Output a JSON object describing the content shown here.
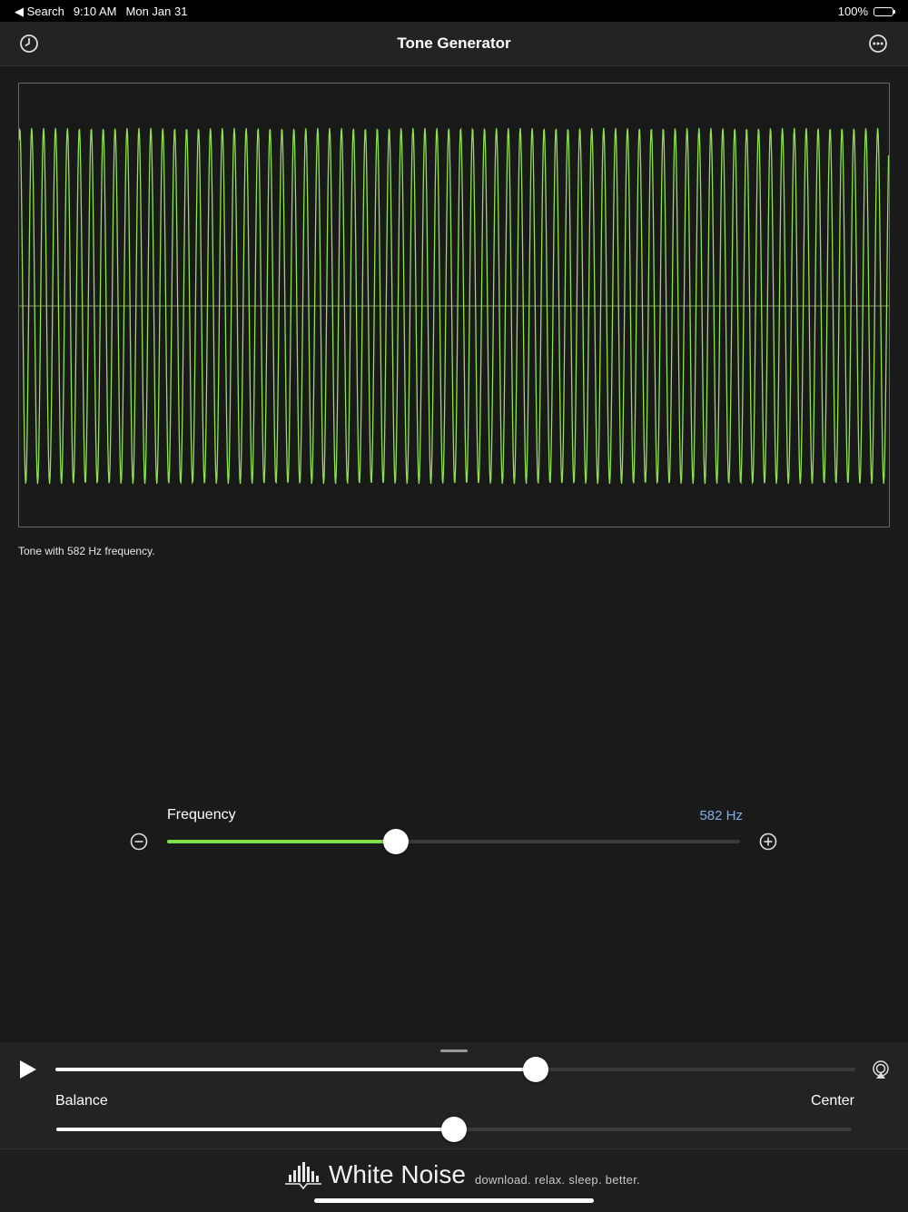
{
  "status": {
    "back_label": "◀ Search",
    "time": "9:10 AM",
    "date": "Mon Jan 31",
    "battery": "100%"
  },
  "nav": {
    "title": "Tone Generator",
    "left_icon": "history-clock-icon",
    "right_icon": "more-ellipsis-icon"
  },
  "waveform": {
    "frequency_hz": 582,
    "color": "#8fe24a",
    "caption": "Tone with 582 Hz frequency."
  },
  "frequency": {
    "label": "Frequency",
    "value": "582 Hz",
    "level": 0.4,
    "accent": "#7fe04a"
  },
  "player": {
    "progress": 0.6,
    "balance_label": "Balance",
    "balance_value": "Center",
    "balance_level": 0.5,
    "play_icon": "play-icon",
    "airplay_icon": "airplay-icon"
  },
  "banner": {
    "brand": "White Noise",
    "tagline": "download. relax. sleep. better.",
    "logo_icon": "white-noise-logo-icon"
  }
}
